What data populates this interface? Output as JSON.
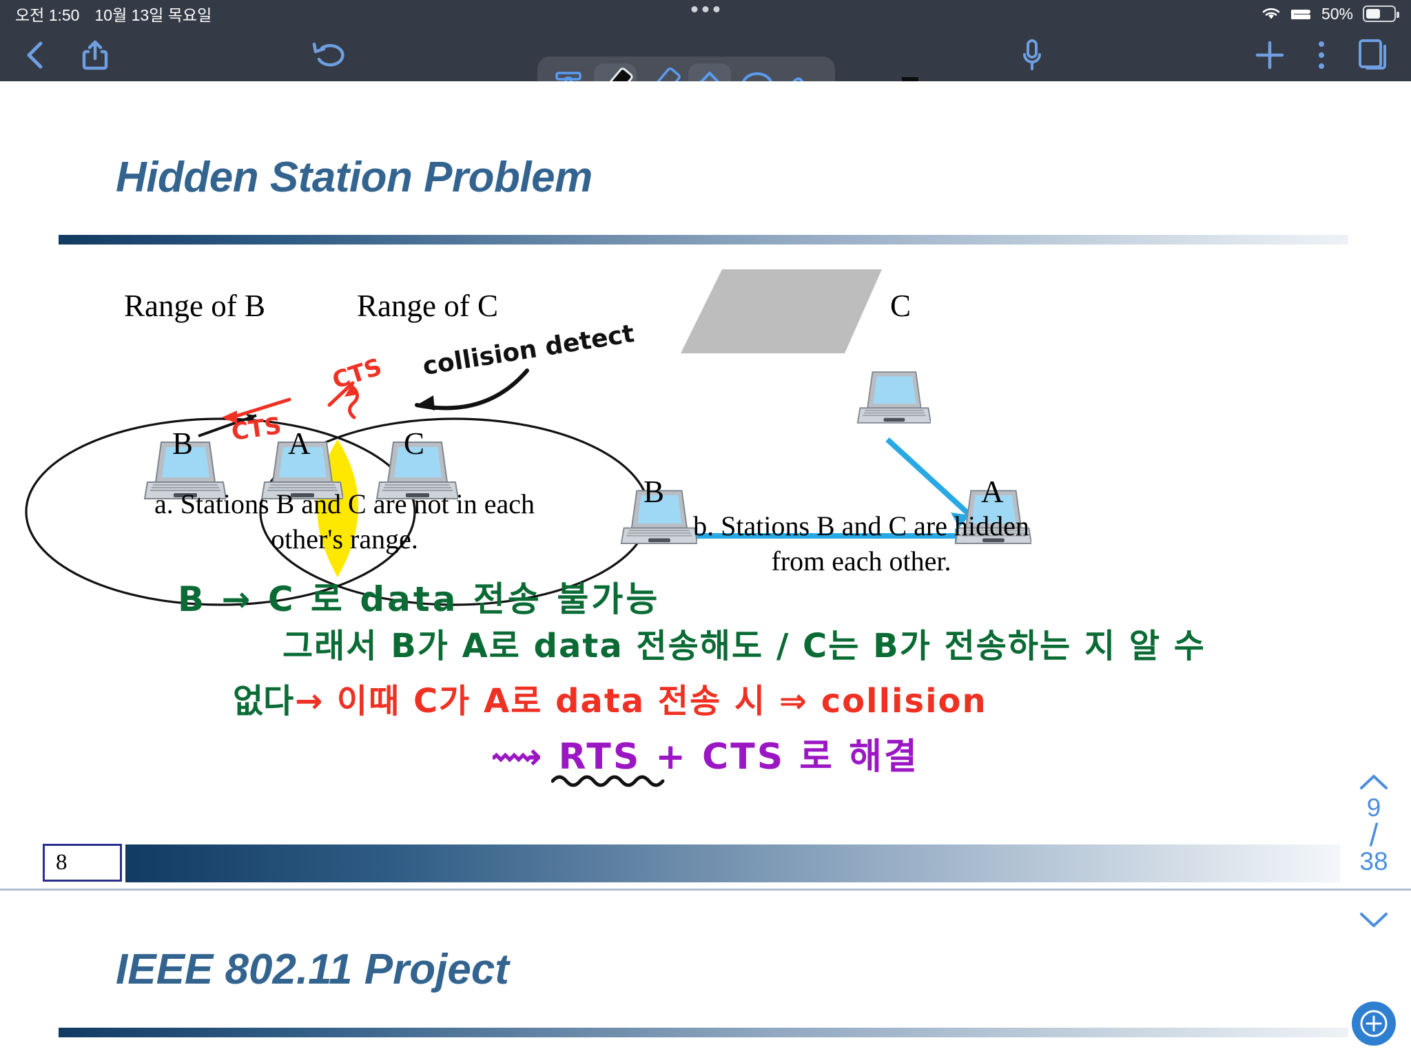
{
  "statusbar": {
    "time": "오전 1:50",
    "date": "10월 13일 목요일",
    "battery_percent": "50%",
    "icons": [
      "wifi-icon",
      "sleep-bed-icon",
      "battery-icon"
    ]
  },
  "toolbar": {
    "back_icon": "chevron-left-icon",
    "share_icon": "share-upload-icon",
    "undo_icon": "undo-arrow-icon",
    "mic_icon": "microphone-icon",
    "add_icon": "plus-icon",
    "more_icon": "more-vertical-icon",
    "pages_icon": "page-copy-icon",
    "tools": [
      {
        "name": "text-tool",
        "icon": "text-T-icon",
        "selected": false
      },
      {
        "name": "pen-tool",
        "icon": "pen-icon",
        "selected": true
      },
      {
        "name": "highlighter-tool",
        "icon": "highlighter-icon",
        "selected": false
      },
      {
        "name": "eraser-tool",
        "icon": "eraser-diamond-icon",
        "selected": false
      },
      {
        "name": "lasso-tool",
        "icon": "lasso-icon",
        "selected": false
      },
      {
        "name": "hand-tool",
        "icon": "hand-pointer-icon",
        "selected": false
      }
    ]
  },
  "palette": {
    "visible": true,
    "close_icon": "close-x-icon",
    "pens": [
      {
        "name": "pen-black",
        "type": "pen",
        "color": "#0d0d0d",
        "selected": true
      },
      {
        "name": "pen-navy",
        "type": "pen",
        "color": "#1c1c8c",
        "selected": false
      },
      {
        "name": "pen-red",
        "type": "pen",
        "color": "#ef2a17",
        "selected": false
      },
      {
        "name": "pen-orange",
        "type": "pen",
        "color": "#f59000",
        "selected": false
      },
      {
        "name": "highlighter-yellow",
        "type": "highlighter",
        "color": "#f2ff1f",
        "body": "#8d8b3a",
        "selected": false
      },
      {
        "name": "highlighter-orange",
        "type": "highlighter",
        "color": "#f79a1e",
        "body": "#9a7531",
        "selected": false
      },
      {
        "name": "highlighter-green",
        "type": "highlighter",
        "color": "#a6e72e",
        "body": "#6f9b36",
        "selected": false
      },
      {
        "name": "eraser-1",
        "type": "eraser",
        "color": "#cfd6de",
        "selected": false
      },
      {
        "name": "eraser-2",
        "type": "eraser",
        "color": "#cfd6de",
        "selected": false
      }
    ]
  },
  "slide": {
    "title": "Hidden Station Problem",
    "title2": "IEEE 802.11 Project",
    "accent_color": "#33648f",
    "figure_a": {
      "range_b_label": "Range of B",
      "range_c_label": "Range of C",
      "node_b": "B",
      "node_a": "A",
      "node_c": "C",
      "caption_line1": "a. Stations B and C are not in each",
      "caption_line2": "other's range.",
      "highlight_color": "#ffe800"
    },
    "figure_b": {
      "node_c": "C",
      "node_b": "B",
      "node_a": "A",
      "caption_line1": "b. Stations B and C are hidden",
      "caption_line2": "from each other.",
      "arrow_color": "#29a9e4",
      "obstacle_color": "#bdbdbd"
    }
  },
  "annotations": [
    {
      "name": "annotation-collision-detect",
      "text": "collision detect",
      "color": "#111111",
      "ink": "black"
    },
    {
      "name": "annotation-cts-left",
      "text": "CTS",
      "color": "#ef3124",
      "ink": "red"
    },
    {
      "name": "annotation-cts-right",
      "text": "CTS",
      "color": "#ef3124",
      "ink": "red"
    },
    {
      "name": "annotation-green-line1",
      "text": "B  →  C 로    data 전송 불가능",
      "color": "#0b6b35",
      "ink": "green"
    },
    {
      "name": "annotation-green-line2",
      "text": "그래서    B가    A로    data    전송해도 /    C는    B가   전송하는 지    알 수",
      "color": "#0b6b35",
      "ink": "green"
    },
    {
      "name": "annotation-green-line3",
      "text": "없다",
      "color": "#0b6b35",
      "ink": "green"
    },
    {
      "name": "annotation-red-line",
      "text": "→    이때    C가  A로     data   전송 시   ⇒  collision",
      "color": "#ef3124",
      "ink": "red"
    },
    {
      "name": "annotation-purple-line",
      "text": "⟿  RTS + CTS 로    해결",
      "color": "#9b17c4",
      "ink": "purple"
    }
  ],
  "footer": {
    "page_box_value": "8",
    "nav_current": "9",
    "nav_separator": "/",
    "nav_total": "38",
    "up_icon": "chevron-up-icon",
    "down_icon": "chevron-down-icon",
    "fab_icon": "add-circle-icon"
  }
}
